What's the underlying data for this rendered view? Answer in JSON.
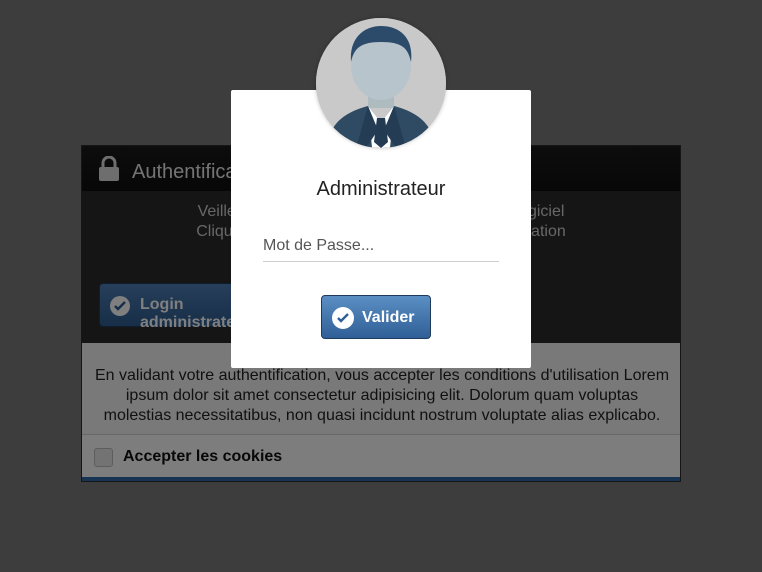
{
  "background": {
    "panel_title": "Authentification",
    "info_line_1": "Veillez vous identifier afin d'obtenir accès au logiciel",
    "info_line_2": "Cliquez sur le bouton afin de lancer l'authentification",
    "login_button_label": "Login administrateur",
    "terms_text": "En validant votre authentification, vous accepter les conditions d'utilisation Lorem ipsum dolor sit amet consectetur adipisicing elit. Dolorum quam voluptas molestias necessitatibus, non quasi incidunt nostrum voluptate alias explicabo.",
    "cookie_label": "Accepter les cookies"
  },
  "modal": {
    "title": "Administrateur",
    "password_placeholder": "Mot de Passe...",
    "password_value": "",
    "submit_label": "Valider"
  },
  "icons": {
    "lock": "lock-icon",
    "avatar": "user-avatar-icon",
    "check": "check-circle-icon"
  },
  "colors": {
    "accent": "#2f6aa6",
    "button_top": "#5b8fc4",
    "button_bottom": "#2f5f96"
  }
}
